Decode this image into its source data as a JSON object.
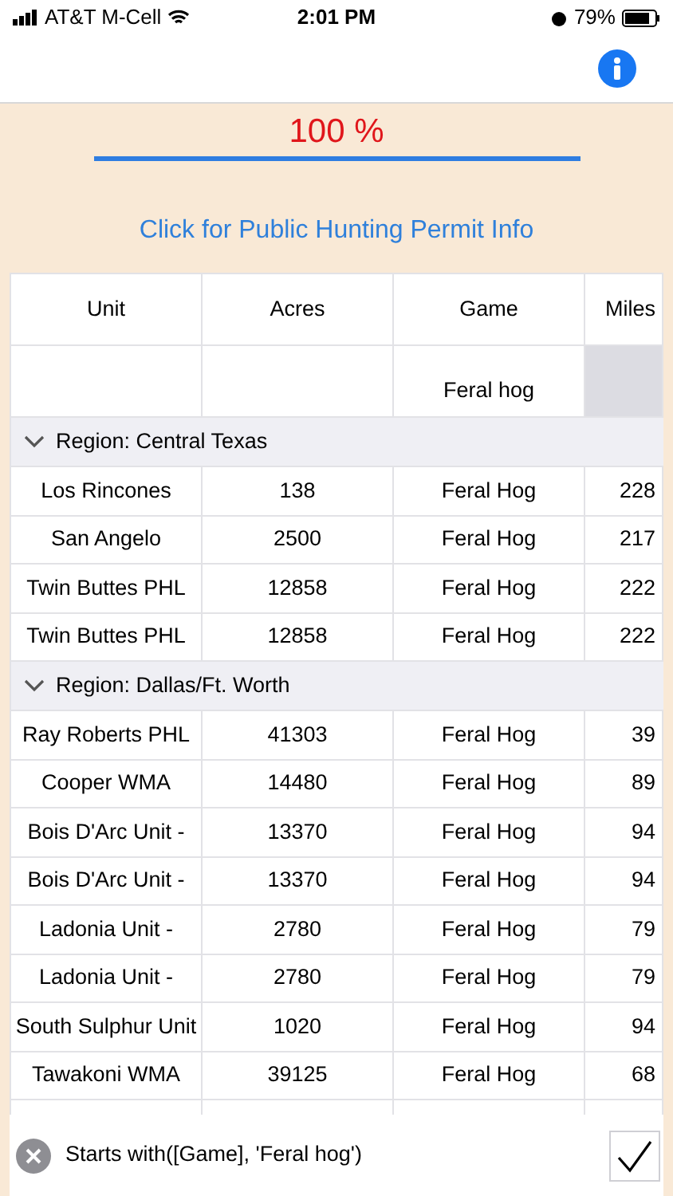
{
  "status_bar": {
    "carrier": "AT&T M-Cell",
    "time": "2:01 PM",
    "battery": "79%"
  },
  "progress": {
    "reading": "100 %",
    "level": 1
  },
  "permit_link": "Click for Public Hunting Permit Info",
  "table": {
    "columns": [
      "Unit",
      "Acres",
      "Game",
      "Miles"
    ],
    "filters": [
      {
        "shaded": false
      },
      {
        "shaded": false
      },
      {
        "value": "Feral hog",
        "shaded": false
      },
      {
        "shaded": true
      }
    ],
    "groups": [
      {
        "label": "Region: Central Texas",
        "expanded": true,
        "rows": [
          [
            "Los Rincones",
            "138",
            "Feral Hog",
            "228"
          ],
          [
            "San Angelo",
            "2500",
            "Feral Hog",
            "217"
          ],
          [
            "Twin Buttes PHL",
            "12858",
            "Feral Hog",
            "222"
          ],
          [
            "Twin Buttes PHL",
            "12858",
            "Feral Hog",
            "222"
          ]
        ]
      },
      {
        "label": "Region: Dallas/Ft. Worth",
        "expanded": true,
        "rows": [
          [
            "Ray Roberts PHL",
            "41303",
            "Feral Hog",
            "39"
          ],
          [
            "Cooper WMA",
            "14480",
            "Feral Hog",
            "89"
          ],
          [
            "Bois D'Arc Unit -",
            "13370",
            "Feral Hog",
            "94"
          ],
          [
            "Bois D'Arc Unit -",
            "13370",
            "Feral Hog",
            "94"
          ],
          [
            "Ladonia Unit -",
            "2780",
            "Feral Hog",
            "79"
          ],
          [
            "Ladonia Unit -",
            "2780",
            "Feral Hog",
            "79"
          ],
          [
            "South Sulphur Unit",
            "1020",
            "Feral Hog",
            "94"
          ],
          [
            "Tawakoni WMA",
            "39125",
            "Feral Hog",
            "68"
          ]
        ]
      }
    ]
  },
  "filter_bar": {
    "expression": "Starts with([Game], 'Feral hog')"
  }
}
